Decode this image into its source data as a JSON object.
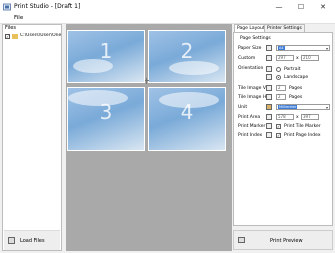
{
  "window": {
    "title": "Print Studio - [Draft 1]",
    "controls": {
      "minimize": "—",
      "maximize": "☐",
      "close": "✕"
    }
  },
  "menu": {
    "file": "File"
  },
  "files": {
    "header": "Files",
    "path": "C:\\Users\\User\\One",
    "checked": true,
    "load_label": "Load Files"
  },
  "canvas": {
    "pages": [
      "1",
      "2",
      "3",
      "4"
    ]
  },
  "tabs": [
    "Page Layout",
    "Printer Settings"
  ],
  "settings": {
    "group": "Page Settings",
    "paper_size": {
      "label": "Paper Size",
      "value": "A4"
    },
    "custom": {
      "label": "Custom",
      "width": "297",
      "times": "x",
      "height": "210"
    },
    "orientation": {
      "label": "Orientation",
      "portrait": "Portrait",
      "landscape": "Landscape",
      "selected": "Landscape"
    },
    "tile_v": {
      "label": "Tile Image V",
      "value": "2",
      "unit": "Pages"
    },
    "tile_h": {
      "label": "Tile Image H",
      "value": "2",
      "unit": "Pages"
    },
    "unit": {
      "label": "Unit",
      "value": "Millimeter"
    },
    "print_area": {
      "label": "Print Area",
      "width": "578",
      "times": "x",
      "height": "397"
    },
    "print_marker": {
      "label": "Print Marker",
      "checkbox": "Print Tile Marker",
      "checked": true
    },
    "print_index": {
      "label": "Print Index",
      "checkbox": "Print Page Index",
      "checked": true
    }
  },
  "preview": {
    "label": "Print Preview"
  }
}
